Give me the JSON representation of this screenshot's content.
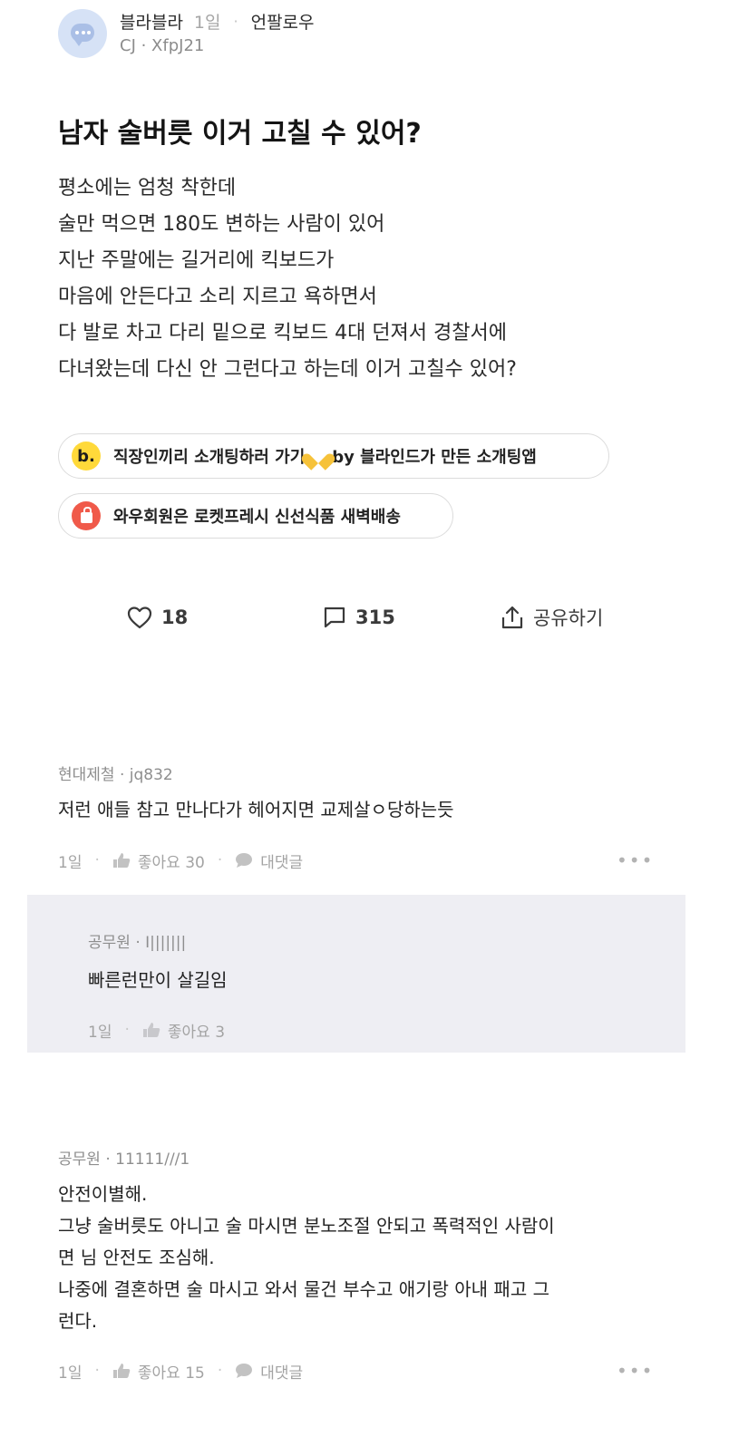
{
  "post": {
    "author": "블라블라",
    "time": "1일",
    "separator": "·",
    "board": "언팔로우",
    "company_user": "CJ · XfpJ21",
    "title": "남자 술버릇 이거 고칠 수 있어?",
    "body_lines": [
      "평소에는 엄청 착한데",
      "술만 먹으면 180도 변하는 사람이 있어",
      "지난 주말에는 길거리에 킥보드가",
      "마음에 안든다고 소리 지르고 욕하면서",
      "다 발로 차고 다리 밑으로 킥보드 4대 던져서 경찰서에",
      "다녀왔는데 다신 안 그런다고 하는데 이거 고칠수 있어?"
    ]
  },
  "ads": {
    "blind": {
      "icon_letter": "b.",
      "text_before": "직장인끼리 소개팅하러 가기",
      "text_after": "by 블라인드가 만든 소개팅앱",
      "icon": "yellow-heart-emoji"
    },
    "coupang": {
      "text": "와우회원은 로켓프레시 신선식품 새벽배송",
      "icon": "shopping-bag-icon"
    }
  },
  "actions": {
    "like_count": "18",
    "comment_count": "315",
    "share_label": "공유하기"
  },
  "comments": [
    {
      "meta": "현대제철 · jq832",
      "lines": [
        "저런 애들 참고 만나다가 헤어지면 교제살ㅇ당하는듯"
      ],
      "time": "1일",
      "likes": "좋아요 30",
      "reply_label": "대댓글",
      "more": "•••"
    },
    {
      "meta": "공무원 · I|||||||",
      "lines": [
        "빠른런만이 살길임"
      ],
      "time": "1일",
      "likes": "좋아요 3"
    },
    {
      "meta": "공무원 · 11111///1",
      "lines": [
        "안전이별해.",
        "그냥 술버릇도 아니고 술 마시면 분노조절 안되고 폭력적인 사람이",
        "면 님 안전도 조심해.",
        "나중에 결혼하면 술 마시고 와서 물건 부수고 애기랑 아내 패고 그",
        "런다."
      ],
      "time": "1일",
      "likes": "좋아요 15",
      "reply_label": "대댓글",
      "more": "•••"
    }
  ],
  "colors": {
    "background": "#ffffff",
    "reply_background": "#eeeef3",
    "blind_yellow": "#ffd93a",
    "coupang_red": "#f05a4a",
    "meta_gray": "#8e8e8e"
  }
}
